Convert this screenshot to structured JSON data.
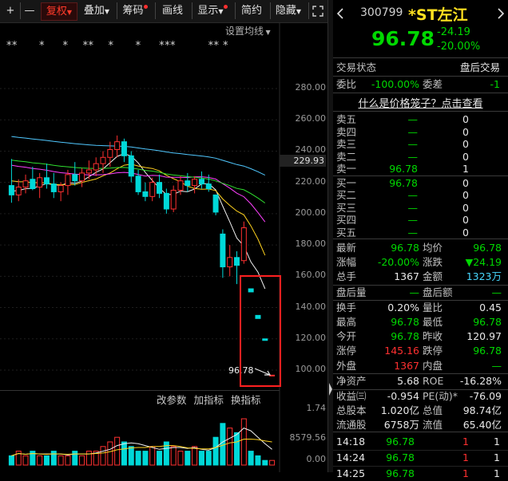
{
  "toolbar": {
    "plus": "+",
    "minus": "—",
    "fuquan": "复权",
    "diejia": "叠加",
    "fuma": "筹码",
    "huaxian": "画线",
    "xianshi": "显示",
    "jianyue": "简约",
    "yincang": "隐藏"
  },
  "chart": {
    "settings_label": "设置均线",
    "current_price_tag": "229.93",
    "last_price_label": "96.78",
    "y_ticks": [
      "280.00",
      "260.00",
      "240.00",
      "220.00",
      "200.00",
      "180.00",
      "160.00",
      "140.00",
      "120.00",
      "100.00"
    ],
    "vol_ticks": [
      "1.74",
      "8579.56",
      "0.00"
    ],
    "indicator_links": [
      "改参数",
      "加指标",
      "换指标"
    ],
    "star_marks": "**      *     *    **    *      *     ***         ** *"
  },
  "chart_data": {
    "type": "candlestick",
    "price_axis": [
      100,
      280
    ],
    "candles": [
      {
        "o": 218,
        "h": 235,
        "l": 207,
        "c": 212
      },
      {
        "o": 212,
        "h": 222,
        "l": 208,
        "c": 217
      },
      {
        "o": 217,
        "h": 225,
        "l": 213,
        "c": 221
      },
      {
        "o": 222,
        "h": 230,
        "l": 215,
        "c": 216
      },
      {
        "o": 217,
        "h": 226,
        "l": 210,
        "c": 223
      },
      {
        "o": 223,
        "h": 232,
        "l": 216,
        "c": 219
      },
      {
        "o": 219,
        "h": 226,
        "l": 210,
        "c": 214
      },
      {
        "o": 214,
        "h": 220,
        "l": 208,
        "c": 218
      },
      {
        "o": 218,
        "h": 228,
        "l": 212,
        "c": 225
      },
      {
        "o": 225,
        "h": 233,
        "l": 218,
        "c": 221
      },
      {
        "o": 221,
        "h": 229,
        "l": 217,
        "c": 226
      },
      {
        "o": 226,
        "h": 234,
        "l": 222,
        "c": 228
      },
      {
        "o": 228,
        "h": 236,
        "l": 224,
        "c": 232
      },
      {
        "o": 232,
        "h": 240,
        "l": 226,
        "c": 236
      },
      {
        "o": 236,
        "h": 246,
        "l": 230,
        "c": 241
      },
      {
        "o": 241,
        "h": 250,
        "l": 236,
        "c": 246
      },
      {
        "o": 246,
        "h": 248,
        "l": 233,
        "c": 237
      },
      {
        "o": 237,
        "h": 240,
        "l": 220,
        "c": 224
      },
      {
        "o": 224,
        "h": 228,
        "l": 212,
        "c": 214
      },
      {
        "o": 214,
        "h": 220,
        "l": 208,
        "c": 211
      },
      {
        "o": 211,
        "h": 223,
        "l": 208,
        "c": 220
      },
      {
        "o": 220,
        "h": 225,
        "l": 210,
        "c": 213
      },
      {
        "o": 213,
        "h": 216,
        "l": 200,
        "c": 203
      },
      {
        "o": 203,
        "h": 218,
        "l": 201,
        "c": 215
      },
      {
        "o": 215,
        "h": 224,
        "l": 212,
        "c": 221
      },
      {
        "o": 221,
        "h": 226,
        "l": 214,
        "c": 218
      },
      {
        "o": 218,
        "h": 224,
        "l": 213,
        "c": 222
      },
      {
        "o": 222,
        "h": 227,
        "l": 216,
        "c": 219
      },
      {
        "o": 219,
        "h": 225,
        "l": 214,
        "c": 216
      },
      {
        "o": 212,
        "h": 212,
        "l": 199,
        "c": 201
      },
      {
        "o": 187,
        "h": 190,
        "l": 159,
        "c": 166
      },
      {
        "o": 166,
        "h": 180,
        "l": 160,
        "c": 172
      },
      {
        "o": 172,
        "h": 176,
        "l": 155,
        "c": 167
      },
      {
        "o": 170,
        "h": 195,
        "l": 168,
        "c": 191
      },
      {
        "o": 152,
        "h": 152,
        "l": 150,
        "c": 150
      },
      {
        "o": 135,
        "h": 135,
        "l": 133,
        "c": 133
      },
      {
        "o": 120,
        "h": 120,
        "l": 119,
        "c": 119
      },
      {
        "o": 96.78,
        "h": 96.78,
        "l": 96.78,
        "c": 96.78
      }
    ],
    "volume": [
      2,
      3,
      2,
      3,
      2,
      2,
      3,
      2,
      2,
      3,
      2,
      3,
      3,
      4,
      5,
      6,
      5,
      4,
      3,
      3,
      4,
      3,
      5,
      4,
      3,
      3,
      4,
      3,
      3,
      6,
      9,
      8,
      7,
      10,
      3,
      2,
      1,
      1
    ]
  },
  "stock": {
    "code": "300799",
    "name": "*ST左江",
    "price": "96.78",
    "change": "-24.19",
    "change_pct": "-20.00%"
  },
  "status": {
    "trade_state_label": "交易状态",
    "trade_state_value": "盘后交易",
    "weibi_label": "委比",
    "weibi_value": "-100.00%",
    "weicha_label": "委差",
    "weicha_value": "-1",
    "link_text": "什么是价格笼子？点击查看"
  },
  "order_book": {
    "sell": [
      {
        "label": "卖五",
        "price": "—",
        "qty": "0"
      },
      {
        "label": "卖四",
        "price": "—",
        "qty": "0"
      },
      {
        "label": "卖三",
        "price": "—",
        "qty": "0"
      },
      {
        "label": "卖二",
        "price": "—",
        "qty": "0"
      },
      {
        "label": "卖一",
        "price": "96.78",
        "qty": "1"
      }
    ],
    "buy": [
      {
        "label": "买一",
        "price": "96.78",
        "qty": "0"
      },
      {
        "label": "买二",
        "price": "—",
        "qty": "0"
      },
      {
        "label": "买三",
        "price": "—",
        "qty": "0"
      },
      {
        "label": "买四",
        "price": "—",
        "qty": "0"
      },
      {
        "label": "买五",
        "price": "—",
        "qty": "0"
      }
    ]
  },
  "stats": [
    {
      "l1": "最新",
      "v1": "96.78",
      "l2": "均价",
      "v2": "96.78"
    },
    {
      "l1": "涨幅",
      "v1": "-20.00%",
      "l2": "涨跌",
      "v2": "▼24.19"
    },
    {
      "l1": "总手",
      "v1": "1367",
      "l2": "金额",
      "v2": "1323万"
    },
    {
      "l1": "盘后量",
      "v1": "—",
      "l2": "盘后额",
      "v2": "—"
    },
    {
      "l1": "换手",
      "v1": "0.20%",
      "l2": "量比",
      "v2": "0.45"
    },
    {
      "l1": "最高",
      "v1": "96.78",
      "l2": "最低",
      "v2": "96.78"
    },
    {
      "l1": "今开",
      "v1": "96.78",
      "l2": "昨收",
      "v2": "120.97"
    },
    {
      "l1": "涨停",
      "v1": "145.16",
      "l2": "跌停",
      "v2": "96.78"
    },
    {
      "l1": "外盘",
      "v1": "1367",
      "l2": "内盘",
      "v2": "—"
    },
    {
      "l1": "净资产",
      "v1": "5.68",
      "l2": "ROE",
      "v2": "-16.28%"
    },
    {
      "l1": "收益㈢",
      "v1": "-0.954",
      "l2": "PE(动)*",
      "v2": "-76.09"
    },
    {
      "l1": "总股本",
      "v1": "1.020亿",
      "l2": "总值",
      "v2": "98.74亿"
    },
    {
      "l1": "流通股",
      "v1": "6758万",
      "l2": "流值",
      "v2": "65.40亿"
    }
  ],
  "ticks": [
    {
      "time": "14:18",
      "price": "96.78",
      "vol": "1",
      "num": "1"
    },
    {
      "time": "14:24",
      "price": "96.78",
      "vol": "1",
      "num": "1"
    },
    {
      "time": "14:25",
      "price": "96.78",
      "vol": "1",
      "num": "1"
    }
  ],
  "colors": {
    "up": "#ff3030",
    "down": "#00d8d8",
    "price_green": "#00d800",
    "highlight_box": "#ff2020"
  }
}
